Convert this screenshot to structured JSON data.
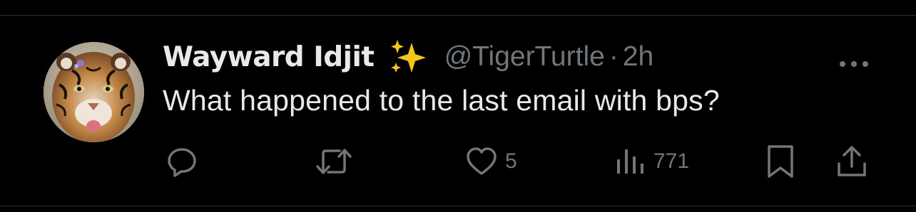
{
  "tweet": {
    "display_name": "Wayward Idjit",
    "verified_emoji_icon": "sparkles-icon",
    "handle": "@TigerTurtle",
    "separator": "·",
    "time": "2h",
    "text": "What happened to the last email with bps?",
    "avatar_description_icon": "tiger-avatar"
  },
  "actions": {
    "reply": {
      "icon": "reply-icon",
      "count": ""
    },
    "retweet": {
      "icon": "retweet-icon",
      "count": ""
    },
    "like": {
      "icon": "heart-icon",
      "count": "5"
    },
    "views": {
      "icon": "views-icon",
      "count": "771"
    },
    "bookmark": {
      "icon": "bookmark-icon"
    },
    "share": {
      "icon": "share-icon"
    }
  },
  "colors": {
    "background": "#000000",
    "text_primary": "#e7e9ea",
    "text_secondary": "#71767b",
    "divider": "#2f3336",
    "sparkle": "#f5c518"
  }
}
